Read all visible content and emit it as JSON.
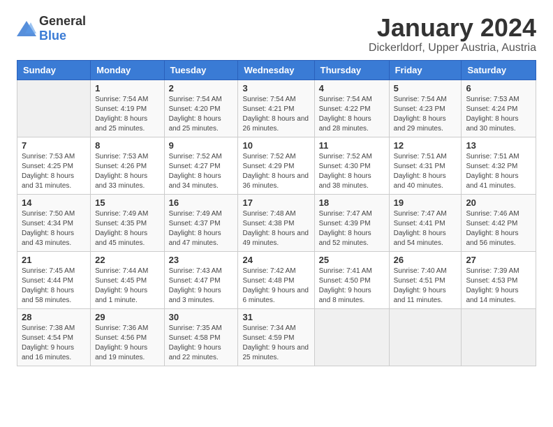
{
  "header": {
    "logo_general": "General",
    "logo_blue": "Blue",
    "title": "January 2024",
    "location": "Dickerldorf, Upper Austria, Austria"
  },
  "days_of_week": [
    "Sunday",
    "Monday",
    "Tuesday",
    "Wednesday",
    "Thursday",
    "Friday",
    "Saturday"
  ],
  "weeks": [
    [
      {
        "day": "",
        "sunrise": "",
        "sunset": "",
        "daylight": ""
      },
      {
        "day": "1",
        "sunrise": "Sunrise: 7:54 AM",
        "sunset": "Sunset: 4:19 PM",
        "daylight": "Daylight: 8 hours and 25 minutes."
      },
      {
        "day": "2",
        "sunrise": "Sunrise: 7:54 AM",
        "sunset": "Sunset: 4:20 PM",
        "daylight": "Daylight: 8 hours and 25 minutes."
      },
      {
        "day": "3",
        "sunrise": "Sunrise: 7:54 AM",
        "sunset": "Sunset: 4:21 PM",
        "daylight": "Daylight: 8 hours and 26 minutes."
      },
      {
        "day": "4",
        "sunrise": "Sunrise: 7:54 AM",
        "sunset": "Sunset: 4:22 PM",
        "daylight": "Daylight: 8 hours and 28 minutes."
      },
      {
        "day": "5",
        "sunrise": "Sunrise: 7:54 AM",
        "sunset": "Sunset: 4:23 PM",
        "daylight": "Daylight: 8 hours and 29 minutes."
      },
      {
        "day": "6",
        "sunrise": "Sunrise: 7:53 AM",
        "sunset": "Sunset: 4:24 PM",
        "daylight": "Daylight: 8 hours and 30 minutes."
      }
    ],
    [
      {
        "day": "7",
        "sunrise": "Sunrise: 7:53 AM",
        "sunset": "Sunset: 4:25 PM",
        "daylight": "Daylight: 8 hours and 31 minutes."
      },
      {
        "day": "8",
        "sunrise": "Sunrise: 7:53 AM",
        "sunset": "Sunset: 4:26 PM",
        "daylight": "Daylight: 8 hours and 33 minutes."
      },
      {
        "day": "9",
        "sunrise": "Sunrise: 7:52 AM",
        "sunset": "Sunset: 4:27 PM",
        "daylight": "Daylight: 8 hours and 34 minutes."
      },
      {
        "day": "10",
        "sunrise": "Sunrise: 7:52 AM",
        "sunset": "Sunset: 4:29 PM",
        "daylight": "Daylight: 8 hours and 36 minutes."
      },
      {
        "day": "11",
        "sunrise": "Sunrise: 7:52 AM",
        "sunset": "Sunset: 4:30 PM",
        "daylight": "Daylight: 8 hours and 38 minutes."
      },
      {
        "day": "12",
        "sunrise": "Sunrise: 7:51 AM",
        "sunset": "Sunset: 4:31 PM",
        "daylight": "Daylight: 8 hours and 40 minutes."
      },
      {
        "day": "13",
        "sunrise": "Sunrise: 7:51 AM",
        "sunset": "Sunset: 4:32 PM",
        "daylight": "Daylight: 8 hours and 41 minutes."
      }
    ],
    [
      {
        "day": "14",
        "sunrise": "Sunrise: 7:50 AM",
        "sunset": "Sunset: 4:34 PM",
        "daylight": "Daylight: 8 hours and 43 minutes."
      },
      {
        "day": "15",
        "sunrise": "Sunrise: 7:49 AM",
        "sunset": "Sunset: 4:35 PM",
        "daylight": "Daylight: 8 hours and 45 minutes."
      },
      {
        "day": "16",
        "sunrise": "Sunrise: 7:49 AM",
        "sunset": "Sunset: 4:37 PM",
        "daylight": "Daylight: 8 hours and 47 minutes."
      },
      {
        "day": "17",
        "sunrise": "Sunrise: 7:48 AM",
        "sunset": "Sunset: 4:38 PM",
        "daylight": "Daylight: 8 hours and 49 minutes."
      },
      {
        "day": "18",
        "sunrise": "Sunrise: 7:47 AM",
        "sunset": "Sunset: 4:39 PM",
        "daylight": "Daylight: 8 hours and 52 minutes."
      },
      {
        "day": "19",
        "sunrise": "Sunrise: 7:47 AM",
        "sunset": "Sunset: 4:41 PM",
        "daylight": "Daylight: 8 hours and 54 minutes."
      },
      {
        "day": "20",
        "sunrise": "Sunrise: 7:46 AM",
        "sunset": "Sunset: 4:42 PM",
        "daylight": "Daylight: 8 hours and 56 minutes."
      }
    ],
    [
      {
        "day": "21",
        "sunrise": "Sunrise: 7:45 AM",
        "sunset": "Sunset: 4:44 PM",
        "daylight": "Daylight: 8 hours and 58 minutes."
      },
      {
        "day": "22",
        "sunrise": "Sunrise: 7:44 AM",
        "sunset": "Sunset: 4:45 PM",
        "daylight": "Daylight: 9 hours and 1 minute."
      },
      {
        "day": "23",
        "sunrise": "Sunrise: 7:43 AM",
        "sunset": "Sunset: 4:47 PM",
        "daylight": "Daylight: 9 hours and 3 minutes."
      },
      {
        "day": "24",
        "sunrise": "Sunrise: 7:42 AM",
        "sunset": "Sunset: 4:48 PM",
        "daylight": "Daylight: 9 hours and 6 minutes."
      },
      {
        "day": "25",
        "sunrise": "Sunrise: 7:41 AM",
        "sunset": "Sunset: 4:50 PM",
        "daylight": "Daylight: 9 hours and 8 minutes."
      },
      {
        "day": "26",
        "sunrise": "Sunrise: 7:40 AM",
        "sunset": "Sunset: 4:51 PM",
        "daylight": "Daylight: 9 hours and 11 minutes."
      },
      {
        "day": "27",
        "sunrise": "Sunrise: 7:39 AM",
        "sunset": "Sunset: 4:53 PM",
        "daylight": "Daylight: 9 hours and 14 minutes."
      }
    ],
    [
      {
        "day": "28",
        "sunrise": "Sunrise: 7:38 AM",
        "sunset": "Sunset: 4:54 PM",
        "daylight": "Daylight: 9 hours and 16 minutes."
      },
      {
        "day": "29",
        "sunrise": "Sunrise: 7:36 AM",
        "sunset": "Sunset: 4:56 PM",
        "daylight": "Daylight: 9 hours and 19 minutes."
      },
      {
        "day": "30",
        "sunrise": "Sunrise: 7:35 AM",
        "sunset": "Sunset: 4:58 PM",
        "daylight": "Daylight: 9 hours and 22 minutes."
      },
      {
        "day": "31",
        "sunrise": "Sunrise: 7:34 AM",
        "sunset": "Sunset: 4:59 PM",
        "daylight": "Daylight: 9 hours and 25 minutes."
      },
      {
        "day": "",
        "sunrise": "",
        "sunset": "",
        "daylight": ""
      },
      {
        "day": "",
        "sunrise": "",
        "sunset": "",
        "daylight": ""
      },
      {
        "day": "",
        "sunrise": "",
        "sunset": "",
        "daylight": ""
      }
    ]
  ]
}
